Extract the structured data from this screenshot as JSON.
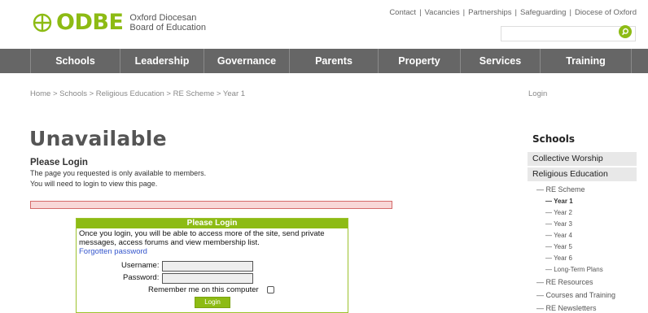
{
  "logo": {
    "name": "ODBE",
    "subtitle_line1": "Oxford Diocesan",
    "subtitle_line2": "Board of Education",
    "brand_color": "#8dbb14"
  },
  "top_links": [
    "Contact",
    "Vacancies",
    "Partnerships",
    "Safeguarding",
    "Diocese of Oxford"
  ],
  "search": {
    "placeholder": "",
    "icon": "search-icon"
  },
  "nav": [
    "Schools",
    "Leadership",
    "Governance",
    "Parents",
    "Property",
    "Services",
    "Training"
  ],
  "breadcrumb": "Home > Schools > Religious Education > RE Scheme > Year 1",
  "login_link": "Login",
  "main": {
    "title": "Unavailable",
    "please_login": "Please Login",
    "message_line1": "The page you requested is only available to members.",
    "message_line2": "You will need to login to view this page."
  },
  "login_box": {
    "header": "Please Login",
    "intro_line1": "Once you login, you will be able to access more of the site, send private",
    "intro_line2": "messages, access forums and view membership list.",
    "forgot": "Forgotten password",
    "username_label": "Username:",
    "password_label": "Password:",
    "remember_label": "Remember me on this computer",
    "button": "Login"
  },
  "sidebar": {
    "title": "Schools",
    "categories": [
      "Collective Worship",
      "Religious Education"
    ],
    "sub_items": [
      "— RE Scheme",
      "— Year 1",
      "— Year 2",
      "— Year 3",
      "— Year 4",
      "— Year 5",
      "— Year 6",
      "— Long-Term Plans",
      "— RE Resources",
      "— Courses and Training",
      "— RE Newsletters"
    ]
  }
}
